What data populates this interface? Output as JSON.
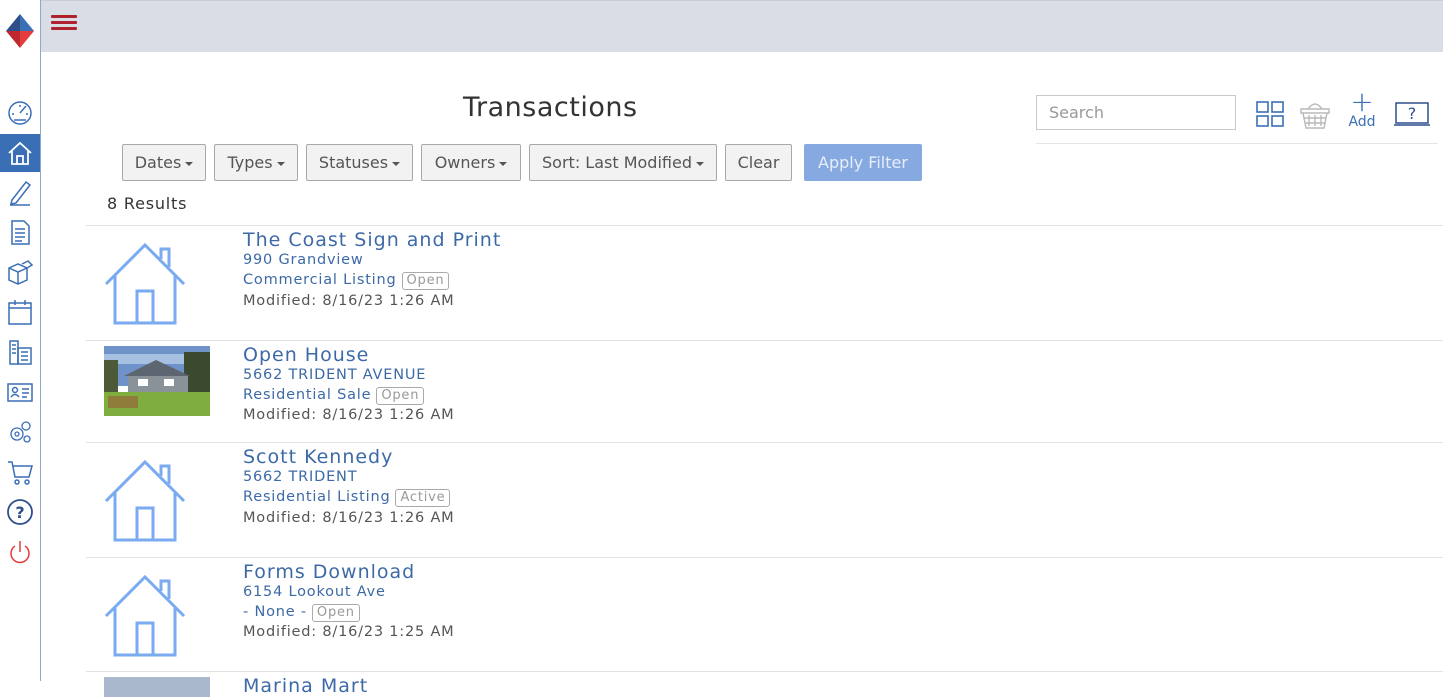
{
  "colors": {
    "accent": "#3a6fb6",
    "brand_red": "#b0212e",
    "link": "#3d6aa6",
    "apply": "#85a9e0"
  },
  "sidebar": {
    "items": [
      {
        "icon": "dashboard-gauge-icon"
      },
      {
        "icon": "home-icon",
        "active": true
      },
      {
        "icon": "pen-icon"
      },
      {
        "icon": "document-icon"
      },
      {
        "icon": "boxes-icon"
      },
      {
        "icon": "calendar-icon"
      },
      {
        "icon": "buildings-icon"
      },
      {
        "icon": "contact-card-icon"
      },
      {
        "icon": "gears-icon"
      },
      {
        "icon": "cart-icon"
      },
      {
        "icon": "help-icon"
      },
      {
        "icon": "power-icon"
      }
    ]
  },
  "header": {
    "title": "Transactions",
    "search_placeholder": "Search",
    "add_label": "Add",
    "add_symbol": "+"
  },
  "filters": {
    "dates": "Dates",
    "types": "Types",
    "statuses": "Statuses",
    "owners": "Owners",
    "sort": "Sort: Last Modified",
    "clear": "Clear",
    "apply": "Apply Filter"
  },
  "results_count": "8 Results",
  "transactions": [
    {
      "title": "The Coast Sign and Print",
      "address": "990 Grandview",
      "type": "Commercial Listing",
      "status": "Open",
      "modified": "Modified: 8/16/23 1:26 AM",
      "thumb": "house-placeholder"
    },
    {
      "title": "Open House",
      "address": "5662 TRIDENT AVENUE",
      "type": "Residential Sale",
      "status": "Open",
      "modified": "Modified: 8/16/23 1:26 AM",
      "thumb": "photo"
    },
    {
      "title": "Scott Kennedy",
      "address": "5662 TRIDENT",
      "type": "Residential Listing",
      "status": "Active",
      "modified": "Modified: 8/16/23 1:26 AM",
      "thumb": "house-placeholder"
    },
    {
      "title": "Forms Download",
      "address": "6154 Lookout Ave",
      "type": "- None -",
      "status": "Open",
      "modified": "Modified: 8/16/23 1:25 AM",
      "thumb": "house-placeholder"
    },
    {
      "title": "Marina Mart",
      "thumb": "photo"
    }
  ]
}
